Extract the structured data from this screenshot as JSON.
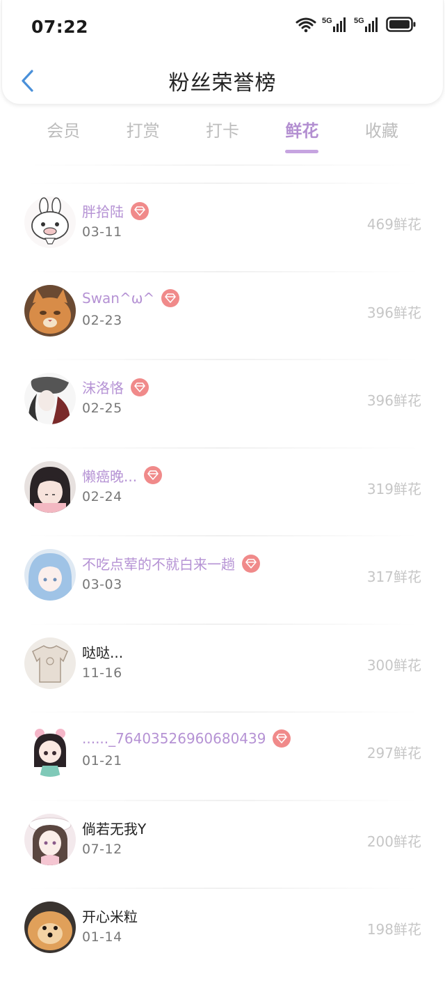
{
  "status_bar": {
    "time": "07:22",
    "network_1": "5G",
    "network_2": "5G"
  },
  "header": {
    "title": "粉丝荣誉榜"
  },
  "tabs": [
    {
      "label": "会员",
      "active": false
    },
    {
      "label": "打赏",
      "active": false
    },
    {
      "label": "打卡",
      "active": false
    },
    {
      "label": "鲜花",
      "active": true
    },
    {
      "label": "收藏",
      "active": false
    }
  ],
  "colors": {
    "accent": "#b592d4",
    "badge": "#f08a8a",
    "count": "#c6c6c6",
    "back_arrow": "#4a90d9"
  },
  "fans": [
    {
      "name": "胖拾陆",
      "date": "03-11",
      "count": "469鲜花",
      "vip": true,
      "avatar": "rabbit-sketch"
    },
    {
      "name": " Swan^ω^",
      "date": "02-23",
      "count": "396鲜花",
      "vip": true,
      "avatar": "orange-cat"
    },
    {
      "name": "沫洛恪",
      "date": "02-25",
      "count": "396鲜花",
      "vip": true,
      "avatar": "ink-portrait"
    },
    {
      "name": "懒癌晚...",
      "date": "02-24",
      "count": "319鲜花",
      "vip": true,
      "avatar": "anime-girl-dark-hair"
    },
    {
      "name": "不吃点荤的不就白来一趟",
      "date": "03-03",
      "count": "317鲜花",
      "vip": true,
      "avatar": "anime-girl-blue-hair"
    },
    {
      "name": "哒哒...",
      "date": "11-16",
      "count": "300鲜花",
      "vip": false,
      "avatar": "shirt-sketch"
    },
    {
      "name": "......_76403526960680439",
      "date": "01-21",
      "count": "297鲜花",
      "vip": true,
      "avatar": "chibi-girl"
    },
    {
      "name": "倘若无我Y",
      "date": "07-12",
      "count": "200鲜花",
      "vip": false,
      "avatar": "anime-girl-hat"
    },
    {
      "name": "开心米粒",
      "date": "01-14",
      "count": "198鲜花",
      "vip": false,
      "avatar": "pomeranian-dog"
    }
  ]
}
